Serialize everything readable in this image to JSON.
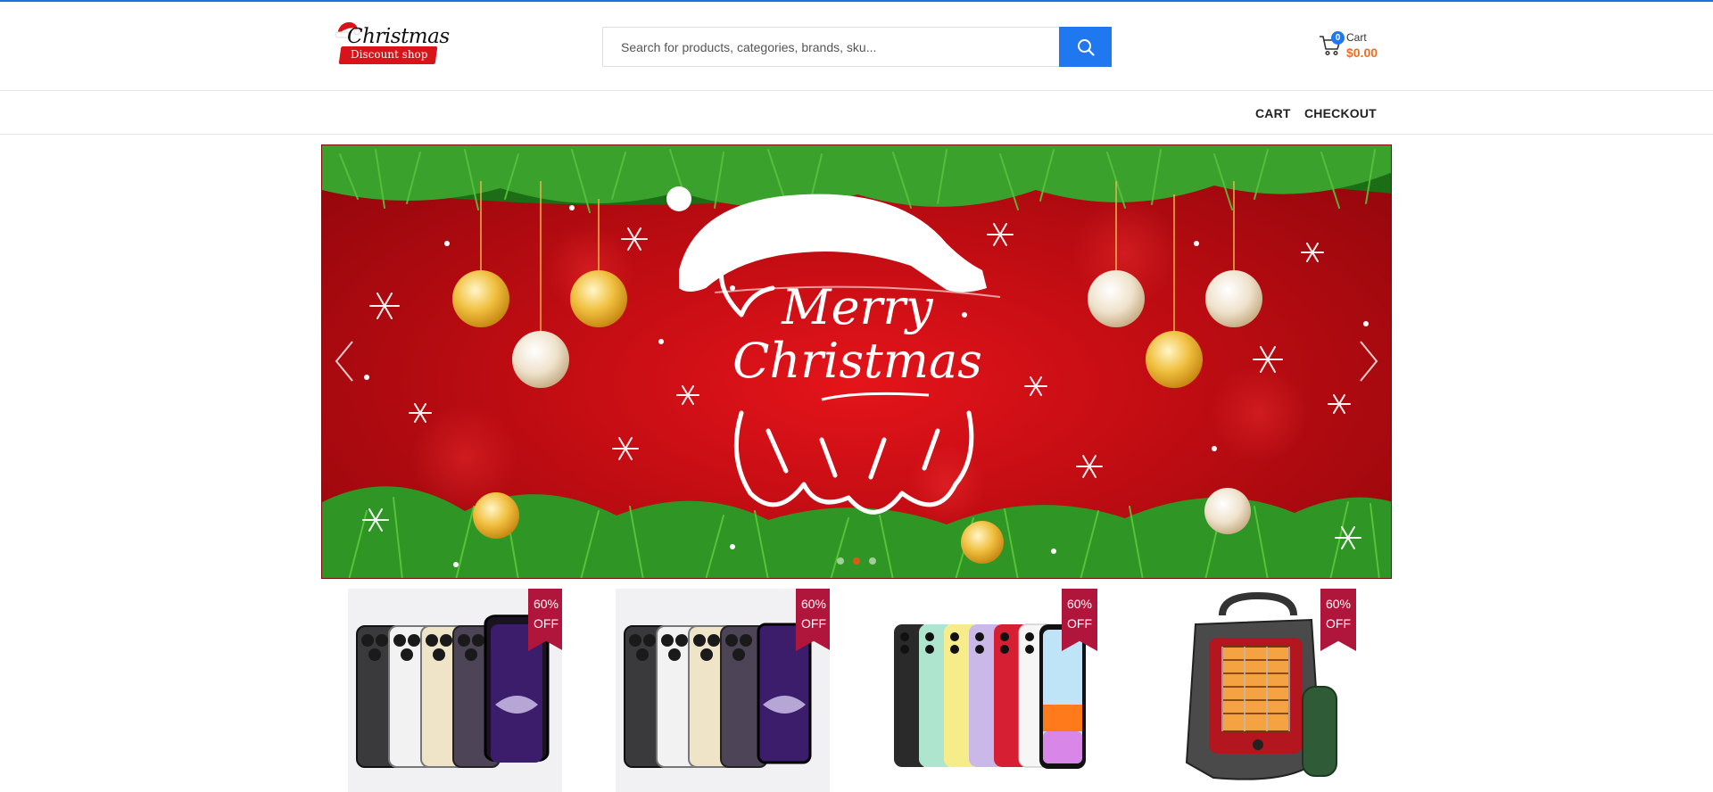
{
  "header": {
    "logo": {
      "title": "Christmas",
      "subtitle": "Discount shop"
    },
    "search": {
      "placeholder": "Search for products, categories, brands, sku...",
      "button_icon": "search-icon"
    },
    "cart": {
      "count": "0",
      "label": "Cart",
      "total": "$0.00",
      "icon": "cart-icon"
    }
  },
  "nav": {
    "items": [
      {
        "label": "CART"
      },
      {
        "label": "CHECKOUT"
      }
    ]
  },
  "slider": {
    "prev_icon": "chevron-left-icon",
    "next_icon": "chevron-right-icon",
    "active_dot": 1,
    "slide_text_line1": "Merry",
    "slide_text_line2": "Christmas"
  },
  "products": [
    {
      "badge_line1": "60%",
      "badge_line2": "OFF",
      "image": "iphone-14-pro-lineup"
    },
    {
      "badge_line1": "60%",
      "badge_line2": "OFF",
      "image": "iphone-14-pro-lineup"
    },
    {
      "badge_line1": "60%",
      "badge_line2": "OFF",
      "image": "iphone-11-colors"
    },
    {
      "badge_line1": "60%",
      "badge_line2": "OFF",
      "image": "portable-propane-heater"
    }
  ],
  "colors": {
    "accent": "#1f78f0",
    "price": "#f06c1e",
    "badge": "#b0163b",
    "banner_red": "#c20d13"
  }
}
